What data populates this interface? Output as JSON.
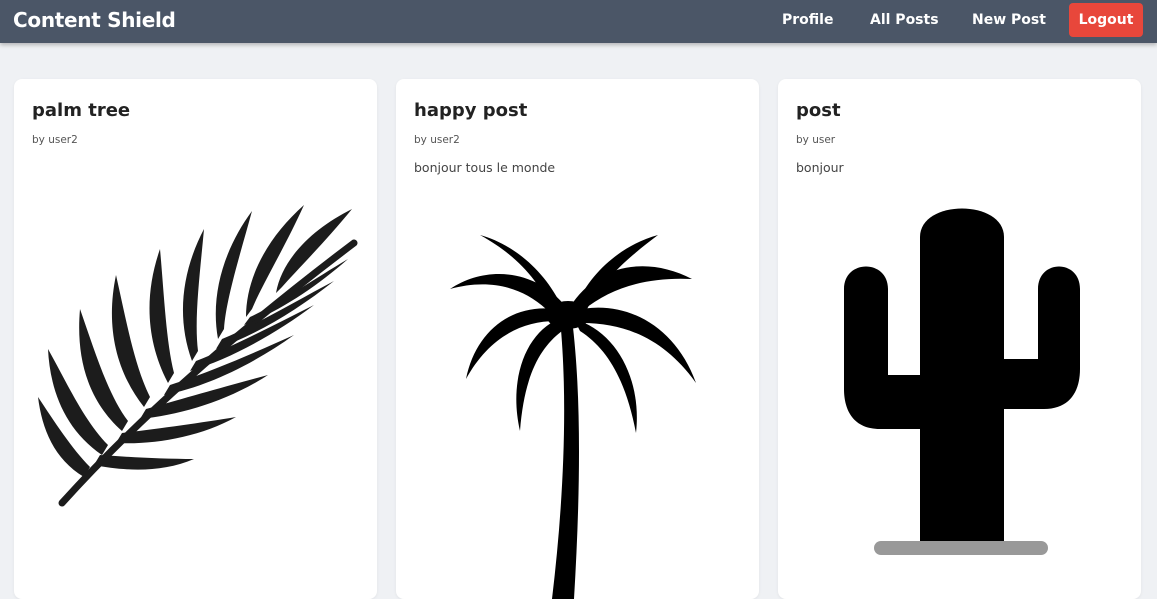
{
  "navbar": {
    "brand": "Content Shield",
    "links": {
      "profile": "Profile",
      "all_posts": "All Posts",
      "new_post": "New Post"
    },
    "logout_label": "Logout",
    "background_color": "#4b5667",
    "logout_color": "#e8473b"
  },
  "posts": [
    {
      "title": "palm tree",
      "author": "by user2",
      "body": "",
      "image_icon": "palm-leaf-icon"
    },
    {
      "title": "happy post",
      "author": "by user2",
      "body": "bonjour tous le monde",
      "image_icon": "palm-tree-icon"
    },
    {
      "title": "post",
      "author": "by user",
      "body": "bonjour",
      "image_icon": "cactus-icon"
    }
  ]
}
